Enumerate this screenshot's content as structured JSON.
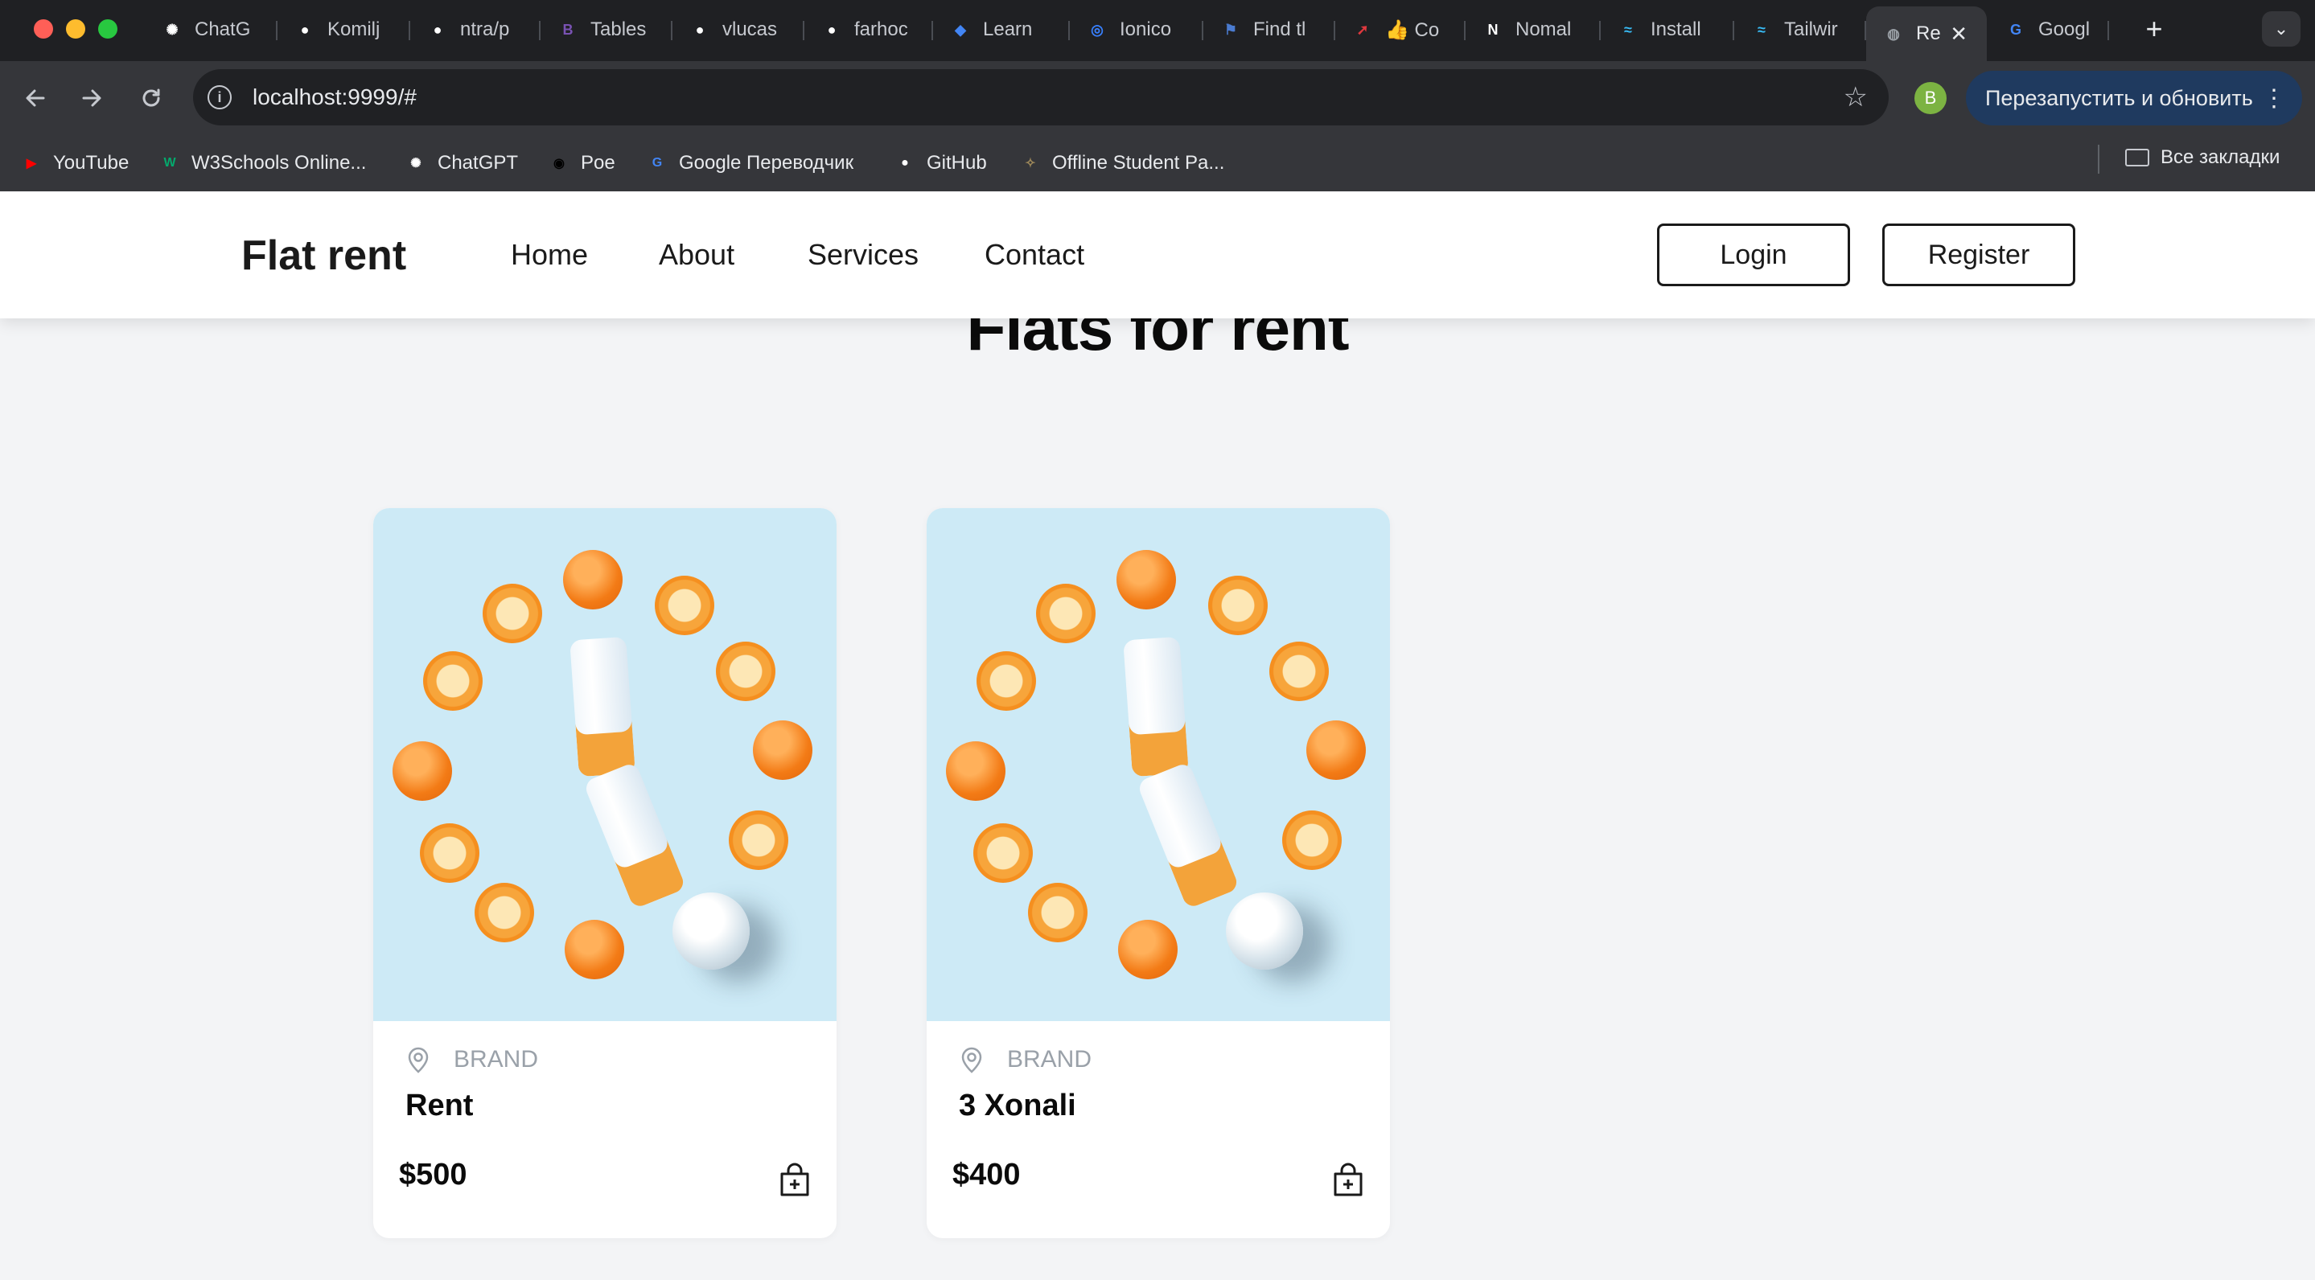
{
  "browser": {
    "tabs": [
      {
        "label": "ChatG",
        "icon": "chatgpt-icon",
        "color": "#ffffff"
      },
      {
        "label": "Komilj",
        "icon": "github-icon",
        "color": "#ffffff"
      },
      {
        "label": "ntra/p",
        "icon": "github-icon",
        "color": "#ffffff"
      },
      {
        "label": "Tables",
        "icon": "bootstrap-icon",
        "color": "#7952b3"
      },
      {
        "label": "vlucas",
        "icon": "github-icon",
        "color": "#ffffff"
      },
      {
        "label": "farhoc",
        "icon": "github-icon",
        "color": "#ffffff"
      },
      {
        "label": "Learn",
        "icon": "learn-icon",
        "color": "#4285f4"
      },
      {
        "label": "Ionico",
        "icon": "ionicons-icon",
        "color": "#3880ff"
      },
      {
        "label": "Find tl",
        "icon": "flag-icon",
        "color": "#4a7bd0"
      },
      {
        "label": "👍 Co",
        "icon": "compass-icon",
        "color": "#e0383e"
      },
      {
        "label": "Nomal",
        "icon": "nomal-icon",
        "color": "#ffffff"
      },
      {
        "label": "Install",
        "icon": "tailwind-icon",
        "color": "#38bdf8"
      },
      {
        "label": "Tailwir",
        "icon": "tailwind-icon",
        "color": "#38bdf8"
      },
      {
        "label": "Re",
        "icon": "globe-icon",
        "color": "#9aa0a6",
        "active": true
      },
      {
        "label": "Googl",
        "icon": "google-translate-icon",
        "color": "#4285f4"
      }
    ],
    "url": "localhost:9999/#",
    "profile_initial": "B",
    "update_button": "Перезапустить и обновить",
    "bookmarks": [
      {
        "label": "YouTube",
        "icon": "youtube-icon",
        "color": "#ff0000"
      },
      {
        "label": "W3Schools Online...",
        "icon": "w3schools-icon",
        "color": "#04aa6d"
      },
      {
        "label": "ChatGPT",
        "icon": "chatgpt-icon",
        "color": "#ffffff"
      },
      {
        "label": "Poe",
        "icon": "poe-icon",
        "color": "#000000"
      },
      {
        "label": "Google Переводчик",
        "icon": "google-translate-icon",
        "color": "#4285f4"
      },
      {
        "label": "GitHub",
        "icon": "github-icon",
        "color": "#ffffff"
      },
      {
        "label": "Offline Student Pa...",
        "icon": "student-portal-icon",
        "color": "#a08a5a"
      }
    ],
    "all_bookmarks": "Все закладки"
  },
  "site": {
    "logo": "Flat rent",
    "nav": [
      "Home",
      "About",
      "Services",
      "Contact"
    ],
    "login": "Login",
    "register": "Register",
    "heading": "Flats for rent"
  },
  "cards": [
    {
      "brand": "BRAND",
      "title": "Rent",
      "price": "$500"
    },
    {
      "brand": "BRAND",
      "title": "3 Xonali",
      "price": "$400"
    }
  ]
}
